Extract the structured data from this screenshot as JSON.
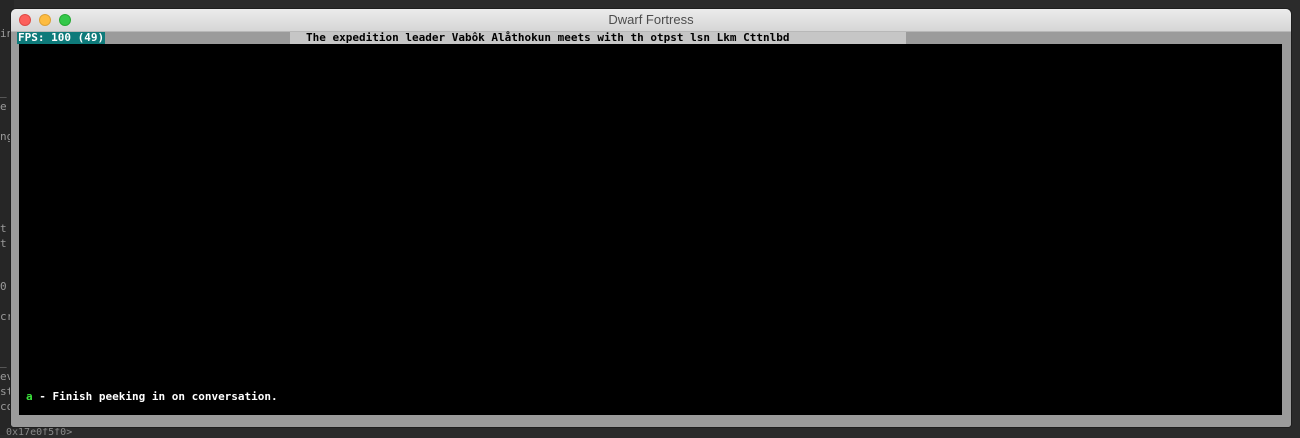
{
  "window": {
    "title": "Dwarf Fortress"
  },
  "status_bar": {
    "fps": "FPS: 100 (49)",
    "announcement": "The expedition leader Vabôk Alåthokun meets with th otpst lsn Lkm Cttnlbd"
  },
  "prompt": {
    "key": "a",
    "separator": " - ",
    "action": "Finish peeking in on conversation."
  },
  "background_terminal": {
    "fragments": [
      "in",
      "_",
      "e",
      "ng",
      "t",
      "t",
      "0",
      "cr",
      "_",
      "ev",
      "st",
      "co"
    ],
    "bottom_text": "0x17e0f5f0>"
  },
  "colors": {
    "fps_bg": "#0e7a7a",
    "key_highlight": "#3be43b",
    "viewport_bg": "#000000",
    "frame_gray": "#9b9b9b"
  }
}
